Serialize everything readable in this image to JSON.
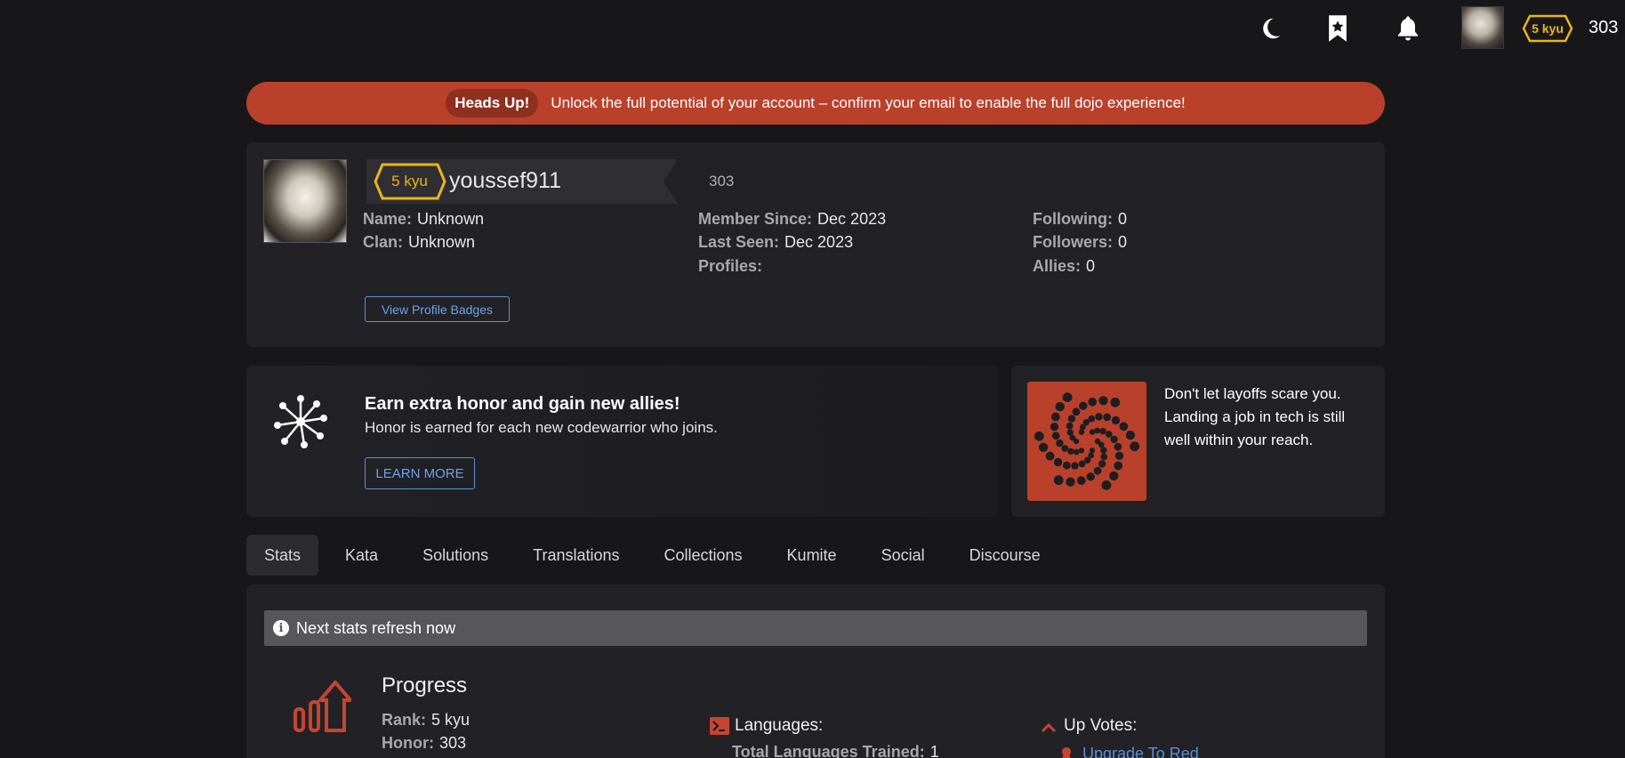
{
  "topbar": {
    "icons": [
      "moon-icon",
      "bookmark-star-icon",
      "bell-icon"
    ],
    "rank_badge": "5 kyu",
    "honor": "303"
  },
  "alert": {
    "pill": "Heads Up!",
    "message": "Unlock the full potential of your account – confirm your email to enable the full dojo experience!"
  },
  "profile": {
    "rank": "5 kyu",
    "username": "youssef911",
    "honor": "303",
    "col1": [
      {
        "label": "Name:",
        "value": "Unknown"
      },
      {
        "label": "Clan:",
        "value": "Unknown"
      }
    ],
    "col2": [
      {
        "label": "Member Since:",
        "value": "Dec 2023"
      },
      {
        "label": "Last Seen:",
        "value": "Dec 2023"
      },
      {
        "label": "Profiles:",
        "value": ""
      }
    ],
    "col3": [
      {
        "label": "Following:",
        "value": "0"
      },
      {
        "label": "Followers:",
        "value": "0"
      },
      {
        "label": "Allies:",
        "value": "0"
      }
    ],
    "badges_button": "View Profile Badges"
  },
  "referral": {
    "title": "Earn extra honor and gain new allies!",
    "subtitle": "Honor is earned for each new codewarrior who joins.",
    "button": "LEARN MORE"
  },
  "ad": {
    "text": "Don't let layoffs scare you. Landing a job in tech is still well within your reach."
  },
  "tabs": [
    "Stats",
    "Kata",
    "Solutions",
    "Translations",
    "Collections",
    "Kumite",
    "Social",
    "Discourse"
  ],
  "stats": {
    "info": "Next stats refresh now",
    "progress_title": "Progress",
    "rank_label": "Rank:",
    "rank_value": "5 kyu",
    "honor_label": "Honor:",
    "honor_value": "303",
    "languages_title": "Languages:",
    "languages_line_label": "Total Languages Trained:",
    "languages_line_value": "1",
    "upvotes_title": "Up Votes:",
    "upvotes_link": "Upgrade To Red"
  },
  "colors": {
    "accent_red": "#b9412c",
    "rank_yellow": "#ecb613",
    "link_blue": "#5b8ed8"
  }
}
